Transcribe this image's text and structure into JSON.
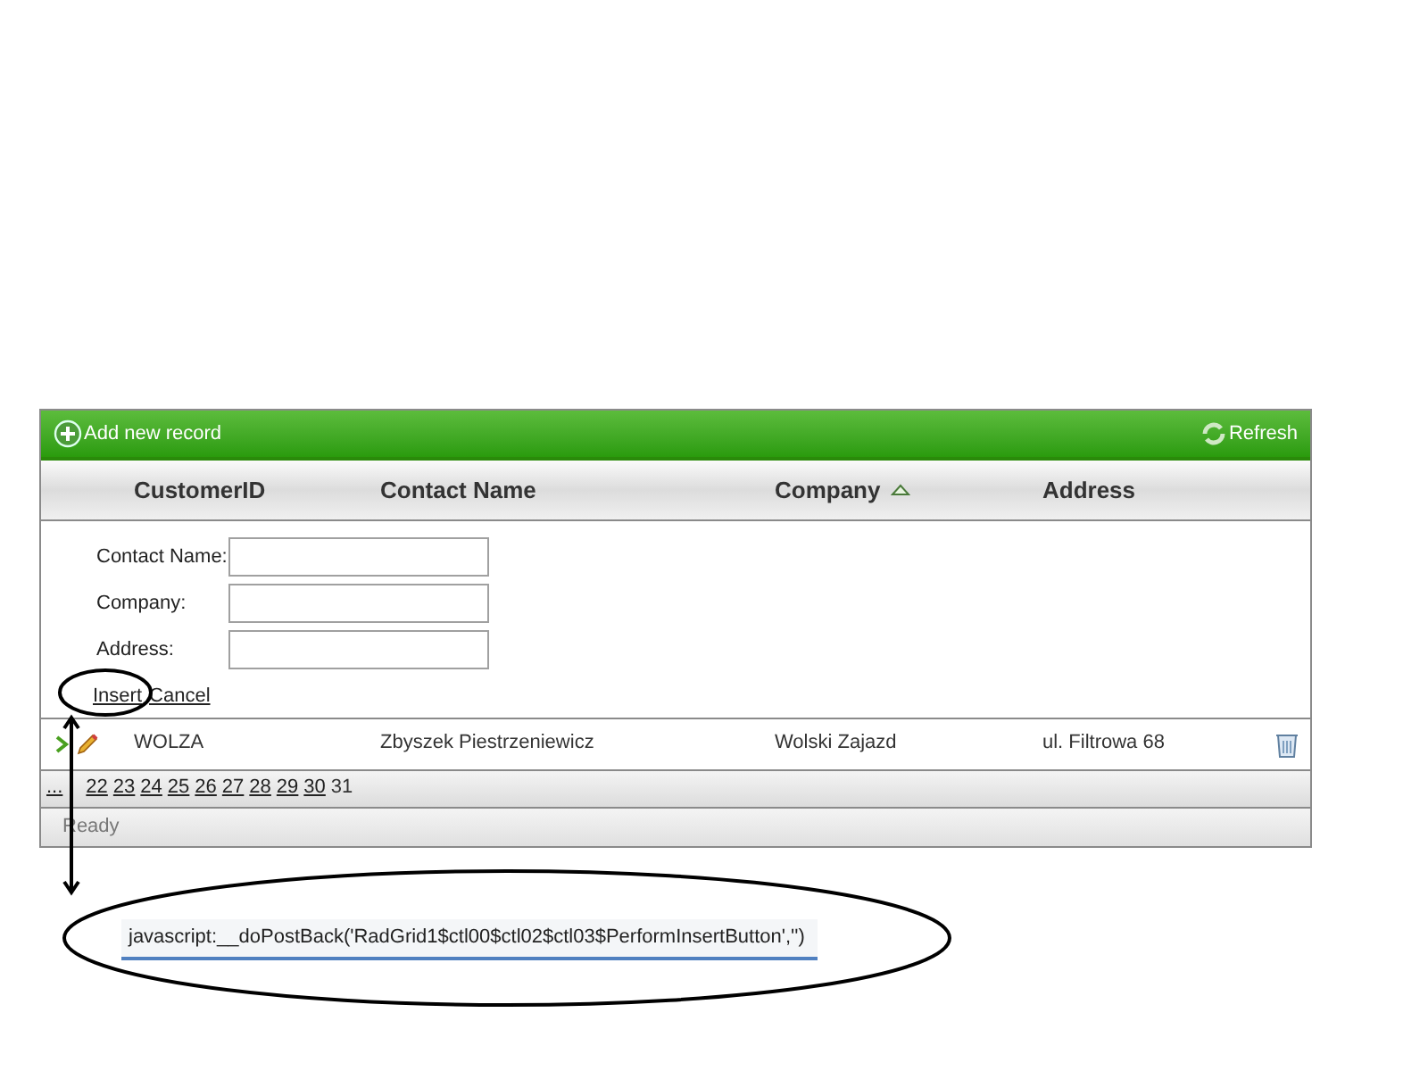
{
  "toolbar": {
    "add": "Add new record",
    "refresh": "Refresh"
  },
  "columns": [
    {
      "label": "CustomerID",
      "sorted": false
    },
    {
      "label": "Contact Name",
      "sorted": false
    },
    {
      "label": "Company",
      "sorted": true
    },
    {
      "label": "Address",
      "sorted": false
    }
  ],
  "insert_form": {
    "fields": [
      {
        "label": "Contact Name:"
      },
      {
        "label": "Company:"
      },
      {
        "label": "Address:"
      }
    ],
    "insert": "Insert",
    "cancel": "Cancel"
  },
  "rows": [
    {
      "cells": [
        "WOLZA",
        "Zbyszek Piestrzeniewicz",
        "Wolski Zajazd",
        "ul. Filtrowa 68"
      ]
    }
  ],
  "pager": [
    {
      "label": "...",
      "selected": false
    },
    {
      "label": "22",
      "selected": false
    },
    {
      "label": "23",
      "selected": false
    },
    {
      "label": "24",
      "selected": false
    },
    {
      "label": "25",
      "selected": false
    },
    {
      "label": "26",
      "selected": false
    },
    {
      "label": "27",
      "selected": false
    },
    {
      "label": "28",
      "selected": false
    },
    {
      "label": "29",
      "selected": false
    },
    {
      "label": "30",
      "selected": false
    },
    {
      "label": "31",
      "selected": true
    }
  ],
  "status_bar": "Ready",
  "status_tooltip": "javascript:__doPostBack('RadGrid1$ctl00$ctl02$ctl03$PerformInsertButton','')"
}
